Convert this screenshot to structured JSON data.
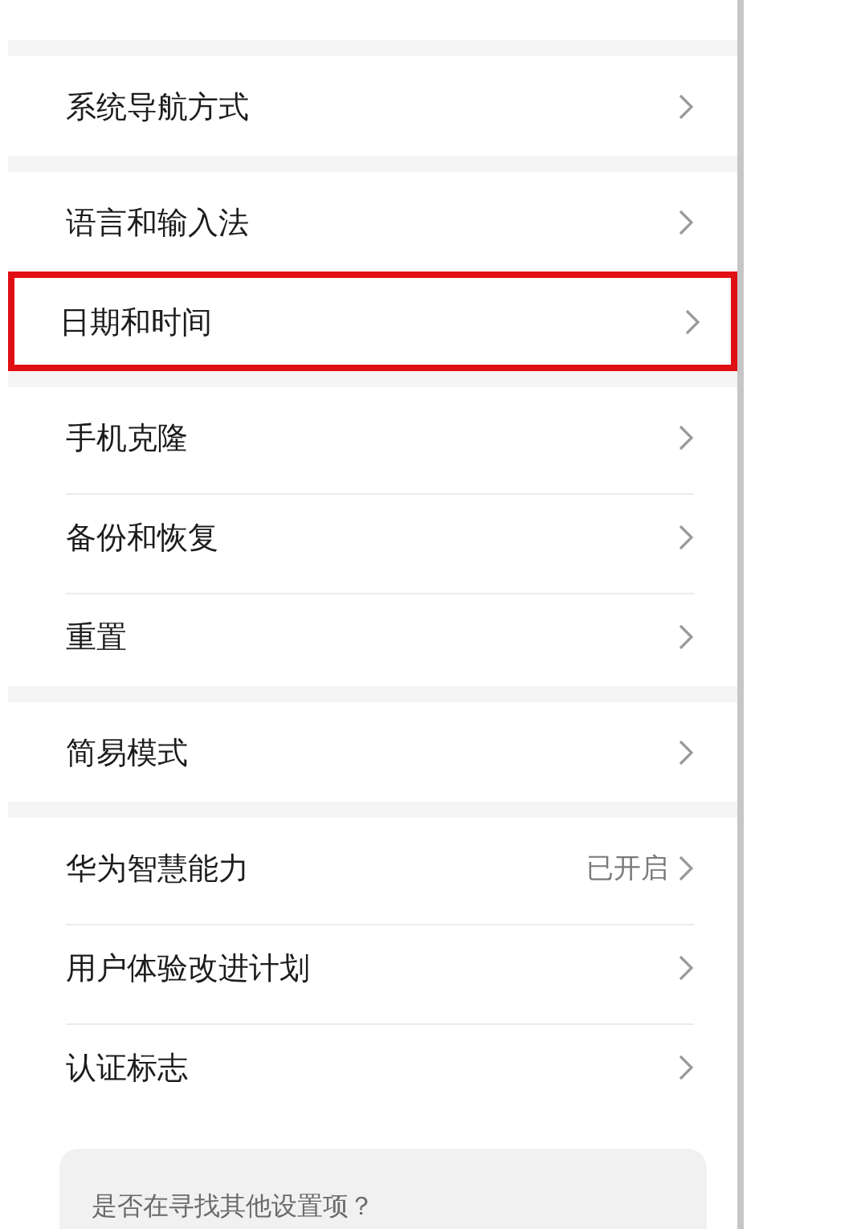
{
  "groups": [
    {
      "items": [
        {
          "label": "系统导航方式",
          "highlighted": false
        }
      ]
    },
    {
      "items": [
        {
          "label": "语言和输入法",
          "highlighted": false
        },
        {
          "label": "日期和时间",
          "highlighted": true
        }
      ]
    },
    {
      "items": [
        {
          "label": "手机克隆",
          "highlighted": false
        },
        {
          "label": "备份和恢复",
          "highlighted": false
        },
        {
          "label": "重置",
          "highlighted": false
        }
      ]
    },
    {
      "items": [
        {
          "label": "简易模式",
          "highlighted": false
        }
      ]
    },
    {
      "items": [
        {
          "label": "华为智慧能力",
          "value": "已开启",
          "highlighted": false
        },
        {
          "label": "用户体验改进计划",
          "highlighted": false
        },
        {
          "label": "认证标志",
          "highlighted": false
        }
      ]
    }
  ],
  "suggestion_card": {
    "text": "是否在寻找其他设置项？"
  }
}
